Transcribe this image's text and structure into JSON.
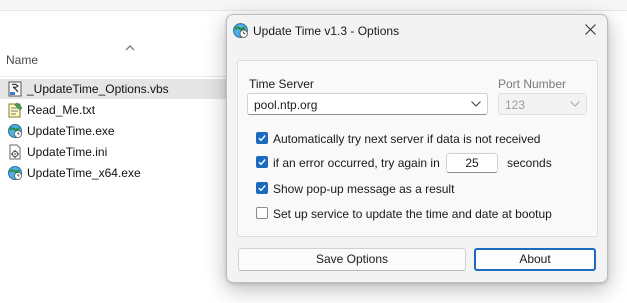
{
  "explorer": {
    "column_header": "Name",
    "files": [
      {
        "name": "_UpdateTime_Options.vbs",
        "icon": "vbs-script-icon",
        "selected": true
      },
      {
        "name": "Read_Me.txt",
        "icon": "notepad-text-icon",
        "selected": false
      },
      {
        "name": "UpdateTime.exe",
        "icon": "globe-clock-app-icon",
        "selected": false
      },
      {
        "name": "UpdateTime.ini",
        "icon": "settings-file-icon",
        "selected": false
      },
      {
        "name": "UpdateTime_x64.exe",
        "icon": "globe-clock-app-icon",
        "selected": false
      }
    ]
  },
  "dialog": {
    "title": "Update Time v1.3 - Options",
    "time_server_label": "Time Server",
    "time_server_value": "pool.ntp.org",
    "port_label": "Port Number",
    "port_value": "123",
    "options": {
      "auto_next_server": {
        "label": "Automatically try next server if data is not received",
        "checked": true
      },
      "retry_on_error": {
        "label_before": "if an error occurred, try again in",
        "value": "25",
        "label_after": "seconds",
        "checked": true
      },
      "show_popup": {
        "label": "Show pop-up message as a result",
        "checked": true
      },
      "setup_service": {
        "label": "Set up service to update the time and date at bootup",
        "checked": false
      }
    },
    "save_button": "Save Options",
    "about_button": "About"
  },
  "colors": {
    "accent": "#1a6bbf",
    "dialog_bg": "#f3f3f3",
    "selection": "#e5e5e5"
  }
}
